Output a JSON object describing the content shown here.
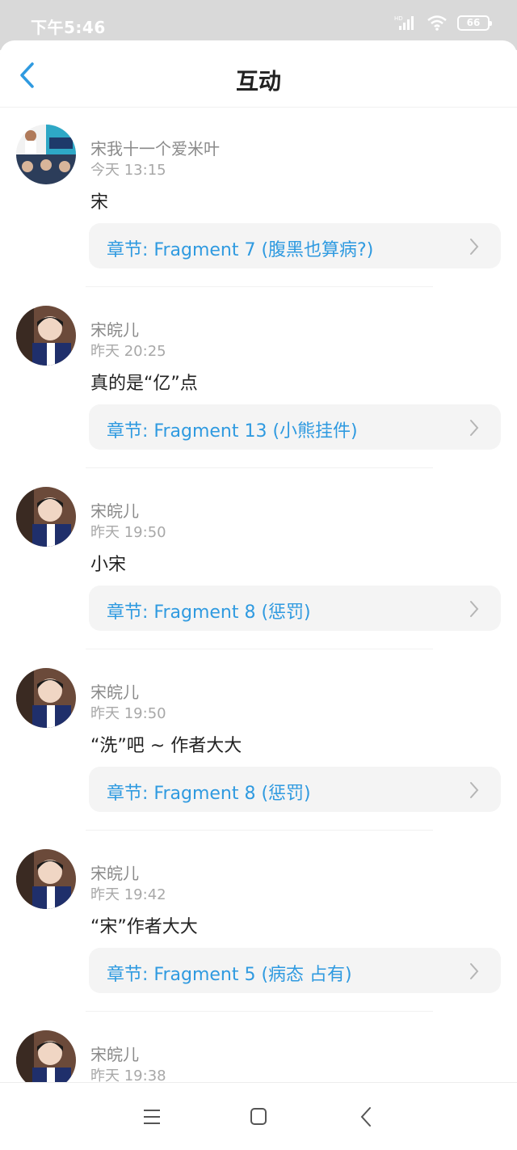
{
  "status_bar": {
    "time": "下午5:46",
    "battery": "66",
    "hd": "HD"
  },
  "header": {
    "title": "互动"
  },
  "comments": [
    {
      "user": "宋我十一个爱米叶",
      "time": "今天 13:15",
      "text": "宋",
      "chapter": "章节: Fragment 7 (腹黑也算病?)"
    },
    {
      "user": "宋皖儿",
      "time": "昨天 20:25",
      "text": "真的是“亿”点",
      "chapter": "章节: Fragment 13 (小熊挂件)"
    },
    {
      "user": "宋皖儿",
      "time": "昨天 19:50",
      "text": "小宋",
      "chapter": "章节: Fragment 8 (惩罚)"
    },
    {
      "user": "宋皖儿",
      "time": "昨天 19:50",
      "text": "“洗”吧 ~ 作者大大",
      "chapter": "章节: Fragment 8 (惩罚)"
    },
    {
      "user": "宋皖儿",
      "time": "昨天 19:42",
      "text": "“宋”作者大大",
      "chapter": "章节: Fragment 5 (病态  占有)"
    },
    {
      "user": "宋皖儿",
      "time": "昨天 19:38"
    }
  ],
  "colors": {
    "accent": "#2f9ae0",
    "card_bg": "#f4f4f4",
    "status_bar": "#d9d9d9"
  }
}
